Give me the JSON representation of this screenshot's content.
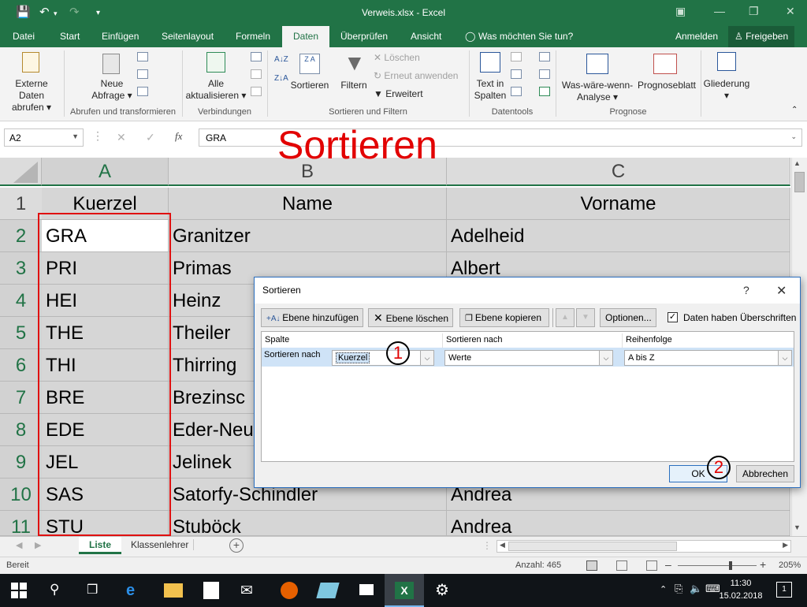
{
  "window": {
    "title": "Verweis.xlsx - Excel"
  },
  "tabs": [
    "Datei",
    "Start",
    "Einfügen",
    "Seitenlayout",
    "Formeln",
    "Daten",
    "Überprüfen",
    "Ansicht"
  ],
  "tell_me": "Was möchten Sie tun?",
  "signin": "Anmelden",
  "share": "Freigeben",
  "ribbon": {
    "external_data": "Externe Daten",
    "external_data2": "abrufen",
    "new_query": "Neue",
    "new_query2": "Abfrage",
    "refresh_all": "Alle",
    "refresh_all2": "aktualisieren",
    "sort": "Sortieren",
    "filter": "Filtern",
    "clear": "Löschen",
    "reapply": "Erneut anwenden",
    "advanced": "Erweitert",
    "text_to_columns": "Text in",
    "text_to_columns2": "Spalten",
    "whatif": "Was-wäre-wenn-",
    "whatif2": "Analyse",
    "forecast": "Prognoseblatt",
    "outline": "Gliederung",
    "groups": {
      "get_transform": "Abrufen und transformieren",
      "connections": "Verbindungen",
      "sort_filter": "Sortieren und Filtern",
      "data_tools": "Datentools",
      "forecast": "Prognose"
    }
  },
  "formula": {
    "namebox": "A2",
    "value": "GRA"
  },
  "annotation": {
    "title": "Sortieren",
    "step1": "1",
    "step2": "2"
  },
  "grid": {
    "columns": [
      "A",
      "B",
      "C"
    ],
    "rows": [
      "1",
      "2",
      "3",
      "4",
      "5",
      "6",
      "7",
      "8",
      "9",
      "10",
      "11"
    ],
    "header": [
      "Kuerzel",
      "Name",
      "Vorname"
    ],
    "data": [
      [
        "GRA",
        "Granitzer",
        "Adelheid"
      ],
      [
        "PRI",
        "Primas",
        "Albert"
      ],
      [
        "HEI",
        "Heinz",
        ""
      ],
      [
        "THE",
        "Theiler",
        ""
      ],
      [
        "THI",
        "Thirring",
        ""
      ],
      [
        "BRE",
        "Brezinsc",
        ""
      ],
      [
        "EDE",
        "Eder-Neu",
        ""
      ],
      [
        "JEL",
        "Jelinek",
        ""
      ],
      [
        "SAS",
        "Satorfy-Schindler",
        "Andrea"
      ],
      [
        "STU",
        "Stuböck",
        "Andrea"
      ]
    ]
  },
  "sheets": {
    "active": "Liste",
    "other": "Klassenlehrer"
  },
  "status": {
    "mode": "Bereit",
    "count": "Anzahl: 465",
    "zoom": "205%"
  },
  "taskbar": {
    "time": "11:30",
    "date": "15.02.2018",
    "notif": "1"
  },
  "dialog": {
    "title": "Sortieren",
    "help": "?",
    "add_level": "Ebene hinzufügen",
    "delete_level": "Ebene löschen",
    "copy_level": "Ebene kopieren",
    "options": "Optionen...",
    "has_headers": "Daten haben Überschriften",
    "col_header": "Spalte",
    "sorton_header": "Sortieren nach",
    "order_header": "Reihenfolge",
    "row_label": "Sortieren nach",
    "column_value": "Kuerzel",
    "sorton_value": "Werte",
    "order_value": "A bis Z",
    "ok": "OK",
    "cancel": "Abbrechen"
  },
  "colors": {
    "excel_green": "#217346",
    "annotation_red": "#e20000"
  }
}
